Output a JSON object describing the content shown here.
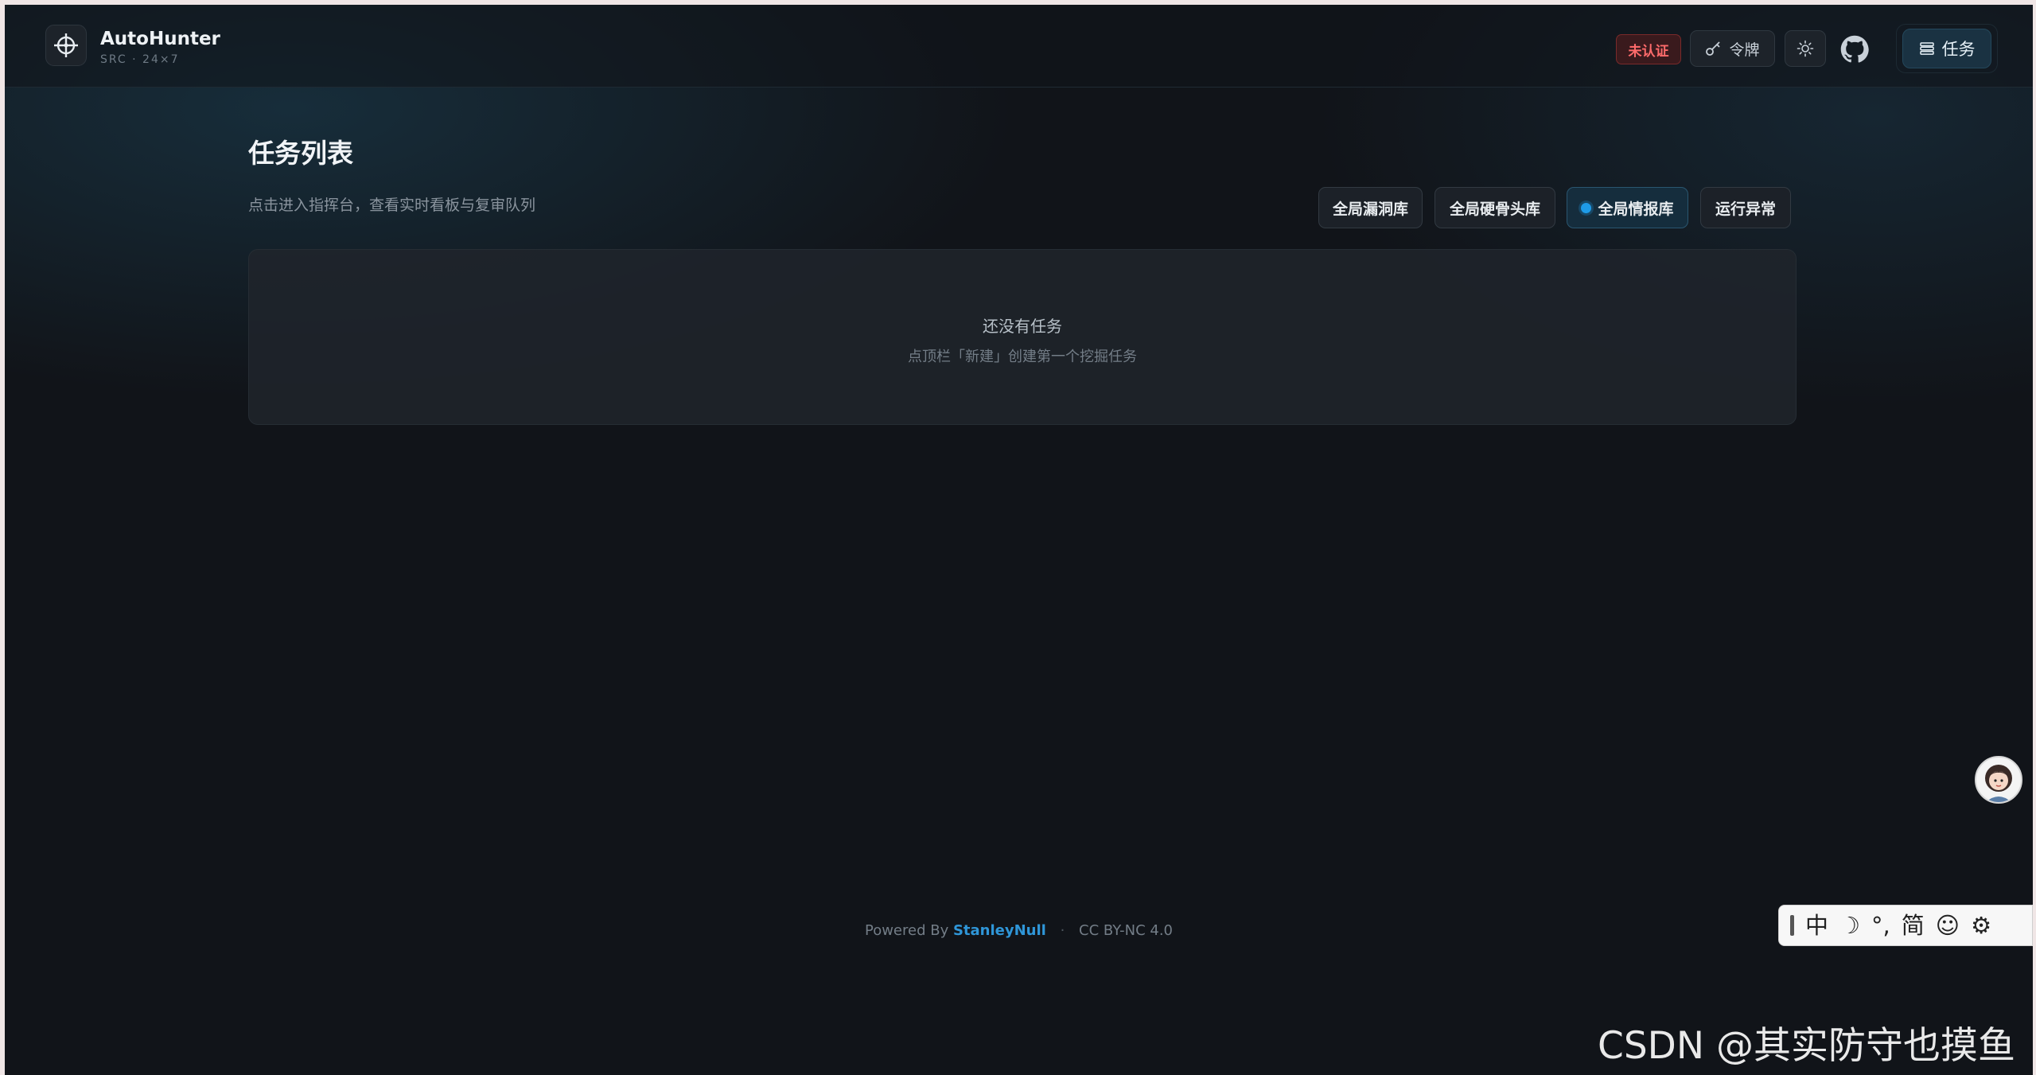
{
  "header": {
    "brand_name": "AutoHunter",
    "brand_sub": "SRC · 24×7",
    "unauth_badge": "未认证",
    "token_label": "令牌",
    "tasks_label": "任务"
  },
  "main": {
    "title": "任务列表",
    "description": "点击进入指挥台，查看实时看板与复审队列",
    "filters": [
      {
        "label": "全局漏洞库",
        "active": false
      },
      {
        "label": "全局硬骨头库",
        "active": false
      },
      {
        "label": "全局情报库",
        "active": true
      },
      {
        "label": "运行异常",
        "active": false
      }
    ],
    "empty_title": "还没有任务",
    "empty_sub": "点顶栏「新建」创建第一个挖掘任务"
  },
  "footer": {
    "powered_by": "Powered By",
    "author": "StanleyNull",
    "separator": "·",
    "license": "CC BY-NC 4.0"
  },
  "ime": {
    "items": [
      "中",
      "☽",
      "°,",
      "简",
      "☺",
      "⚙"
    ]
  },
  "watermark": "CSDN @其实防守也摸鱼",
  "colors": {
    "accent": "#1e9be8",
    "danger": "#ff6b6b",
    "background": "#111419"
  }
}
